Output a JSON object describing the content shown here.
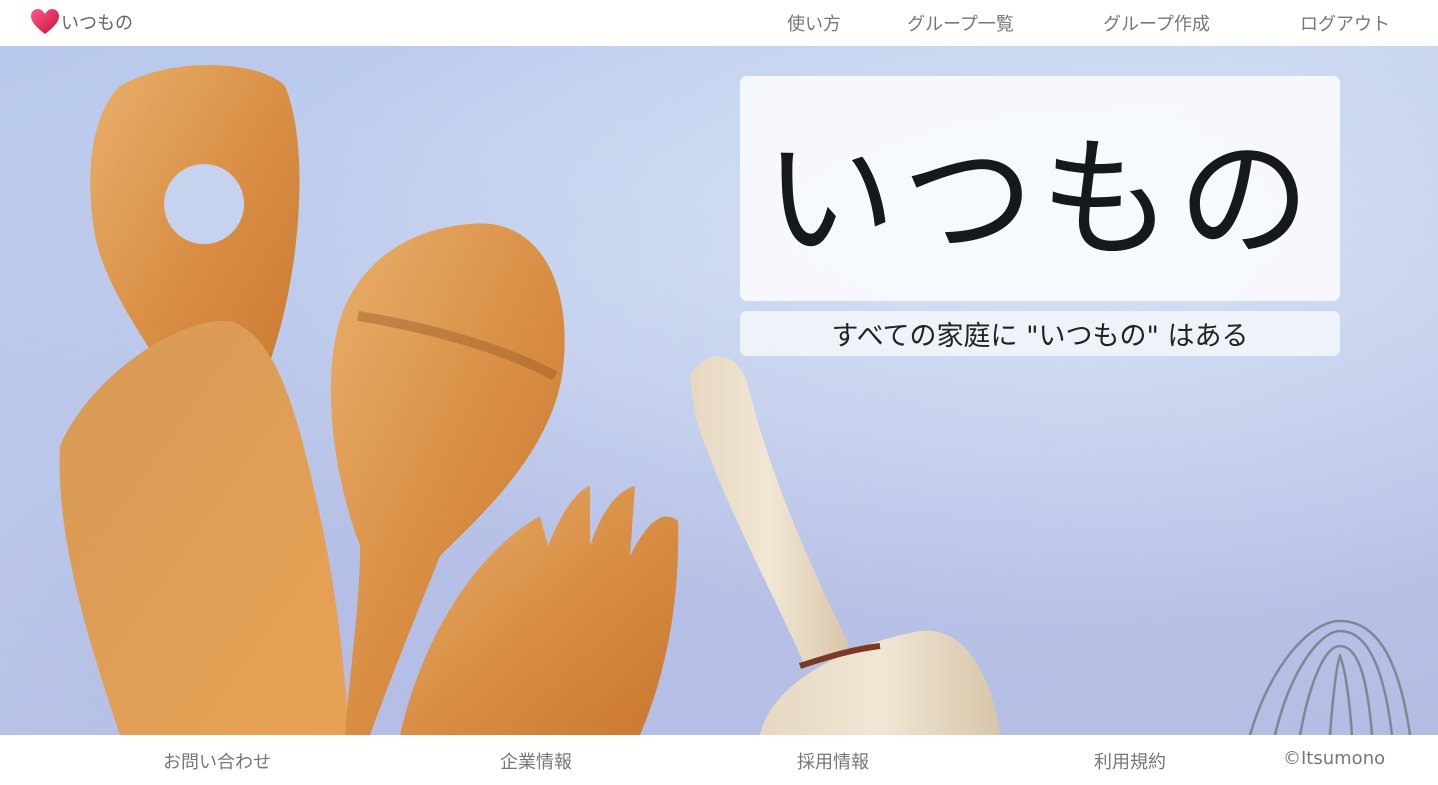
{
  "navbar": {
    "brand_label": "いつもの",
    "items": [
      {
        "label": "使い方"
      },
      {
        "label": "グループ一覧"
      },
      {
        "label": "グループ作成"
      },
      {
        "label": "ログアウト"
      }
    ]
  },
  "hero": {
    "title": "いつもの",
    "subtitle": "すべての家庭に \"いつもの\" はある"
  },
  "footer": {
    "links": [
      {
        "label": "お問い合わせ"
      },
      {
        "label": "企業情報"
      },
      {
        "label": "採用情報"
      },
      {
        "label": "利用規約"
      }
    ],
    "copyright": "©Itsumono"
  },
  "colors": {
    "brand_heart": "#e0245e",
    "nav_text": "#777777",
    "hero_bg": "#c3d0ee",
    "wood": "#d9914a"
  },
  "icons": {
    "brand": "heart-icon"
  }
}
